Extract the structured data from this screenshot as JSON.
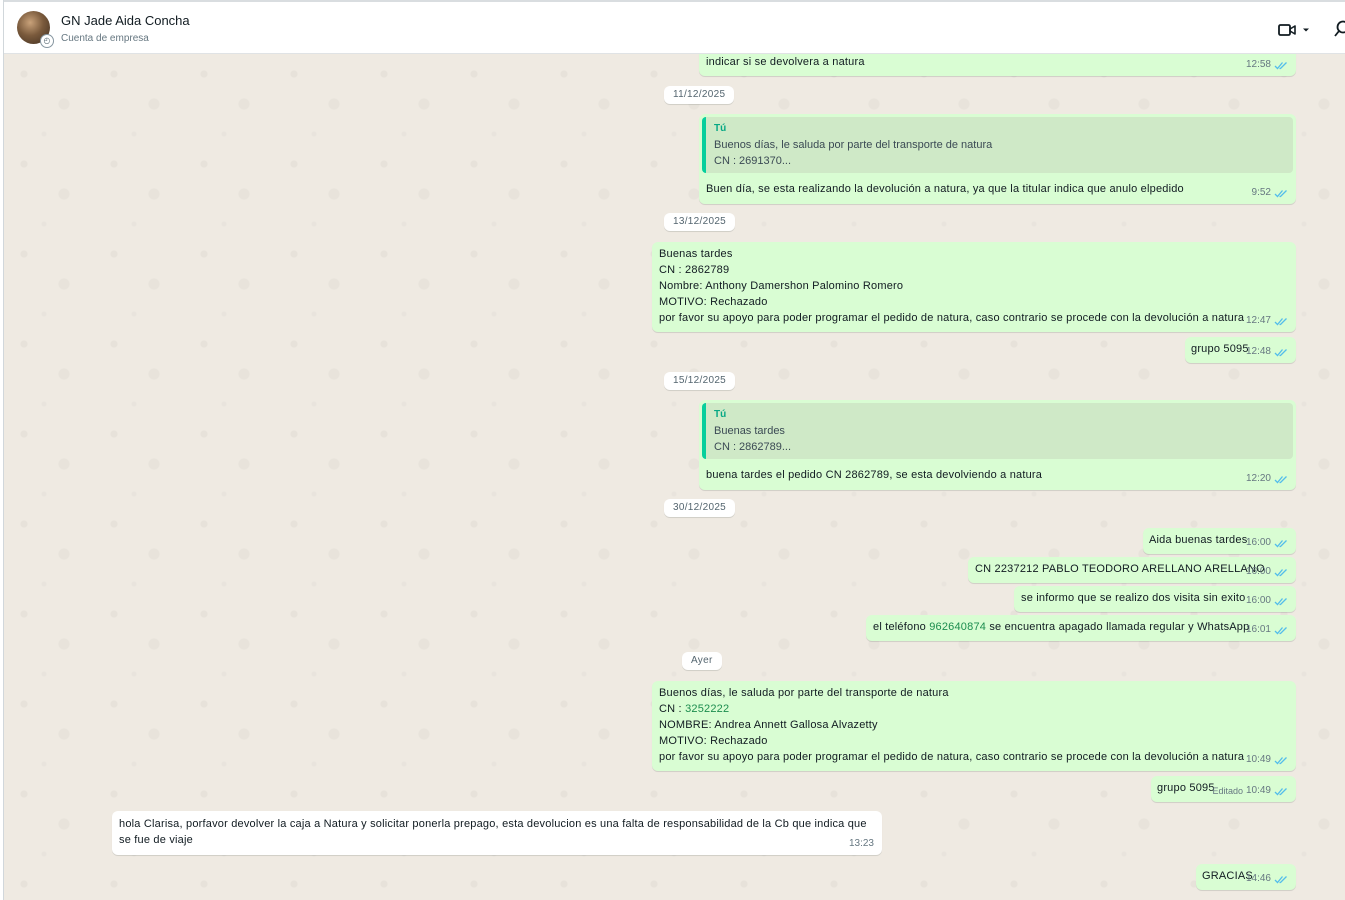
{
  "header": {
    "contact_name": "GN Jade Aida Concha",
    "contact_subtitle": "Cuenta de empresa"
  },
  "messages": {
    "m1": {
      "text": "indicar si se devolvera a natura",
      "time": "12:58"
    },
    "d1": "11/12/2025",
    "m2": {
      "quote_author": "Tú",
      "quote_line1": "Buenos días, le saluda por parte del transporte de natura",
      "quote_line2": "CN : 2691370...",
      "text": "Buen día, se esta realizando la  devolución a natura, ya que la titular indica que anulo elpedido",
      "time": "9:52"
    },
    "d2": "13/12/2025",
    "m3": {
      "line1": "Buenas tardes",
      "line2": "CN : 2862789",
      "line3": "Nombre: Anthony Damershon  Palomino Romero",
      "line4": "MOTIVO: Rechazado",
      "line5": " por favor  su apoyo para poder programar el pedido de natura, caso contrario se procede con la devolución a natura",
      "time": "12:47"
    },
    "m4": {
      "text": "grupo 5095",
      "time": "12:48"
    },
    "d3": "15/12/2025",
    "m5": {
      "quote_author": "Tú",
      "quote_line1": "Buenas tardes",
      "quote_line2": "CN : 2862789...",
      "text": "buena tardes el pedido CN 2862789, se esta devolviendo a natura",
      "time": "12:20"
    },
    "d4": "30/12/2025",
    "m6": {
      "text": "Aida buenas tardes",
      "time": "16:00"
    },
    "m7": {
      "text": "CN 2237212 PABLO TEODORO ARELLANO ARELLANO",
      "time": "16:00"
    },
    "m8": {
      "text": "se informo que se realizo dos visita sin exito",
      "time": "16:00"
    },
    "m9": {
      "text_before": "el teléfono ",
      "phone": "962640874",
      "text_after": " se encuentra apagado llamada regular y WhatsApp",
      "time": "16:01"
    },
    "d5": "Ayer",
    "m10": {
      "line1": "Buenos días, le saluda por parte del transporte de natura",
      "line2_label": "CN : ",
      "line2_num": "3252222",
      "line3": "NOMBRE:  Andrea Annett Gallosa Alvazetty",
      "line4": "MOTIVO: Rechazado",
      "line5": " por favor  su apoyo para poder programar el pedido de natura, caso contrario se procede con la devolución a natura",
      "time": "10:49"
    },
    "m11": {
      "text": "grupo 5095",
      "edited": "Editado",
      "time": "10:49"
    },
    "m12": {
      "line1": "hola Clarisa, porfavor devolver la caja a Natura y solicitar ponerla prepago, esta devolucion es una falta de responsabilidad de la Cb que indica que",
      "line2": "se fue de viaje",
      "time": "13:23"
    },
    "m13": {
      "text": "GRACIAS",
      "time": "14:46"
    }
  },
  "colors": {
    "outgoing_bubble": "#d9fdd3",
    "incoming_bubble": "#ffffff",
    "chat_background": "#efeae2",
    "read_ticks": "#53bdeb"
  }
}
